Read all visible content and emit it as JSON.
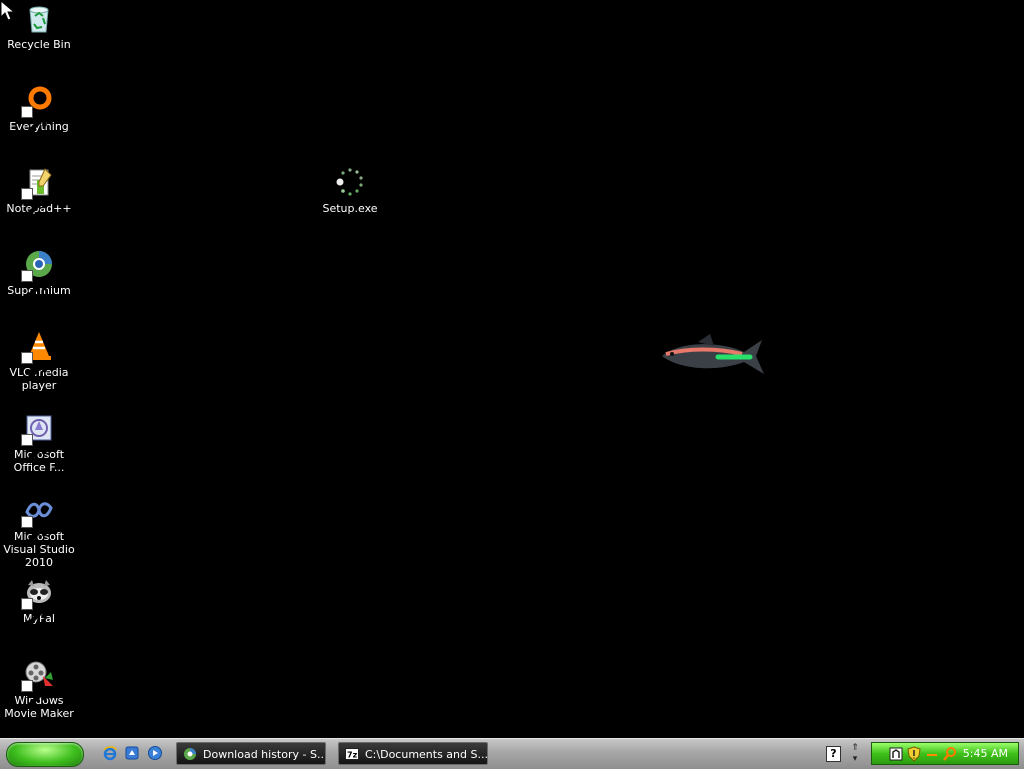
{
  "desktop": {
    "icons": [
      {
        "label": "Recycle Bin",
        "icon": "recycle-bin-icon",
        "shortcut": false
      },
      {
        "label": "Everything",
        "icon": "everything-icon",
        "shortcut": true
      },
      {
        "label": "Notepad++",
        "icon": "notepadpp-icon",
        "shortcut": true
      },
      {
        "label": "Supermium",
        "icon": "supermium-icon",
        "shortcut": true
      },
      {
        "label": "VLC media player",
        "icon": "vlc-icon",
        "shortcut": true
      },
      {
        "label": "Microsoft Office F...",
        "icon": "office-icon",
        "shortcut": true
      },
      {
        "label": "Microsoft Visual Studio 2010",
        "icon": "visual-studio-icon",
        "shortcut": true
      },
      {
        "label": "MyPal",
        "icon": "mypal-icon",
        "shortcut": true
      },
      {
        "label": "Windows Movie Maker",
        "icon": "movie-maker-icon",
        "shortcut": true
      }
    ],
    "setup_icon": {
      "label": "Setup.exe",
      "icon": "setup-loading-icon"
    }
  },
  "taskbar": {
    "quick_launch": [
      {
        "icon": "internet-explorer-icon"
      },
      {
        "icon": "show-desktop-icon"
      },
      {
        "icon": "media-player-icon"
      }
    ],
    "tasks": [
      {
        "label": "Download history - S...",
        "icon": "supermium-icon"
      },
      {
        "label": "C:\\Documents and S...",
        "icon": "7zip-icon"
      }
    ],
    "help_glyph": "?",
    "tray_chevron": "⇑",
    "tray": {
      "icons": [
        "network-icon",
        "security-shield-icon",
        "dash-icon",
        "search-icon"
      ],
      "clock": "5:45 AM"
    }
  },
  "colors": {
    "desktop_bg": "#000000",
    "start_button": "#3fbf1e",
    "tray_bg": "#3fc21a",
    "task_bg": "#141414"
  }
}
